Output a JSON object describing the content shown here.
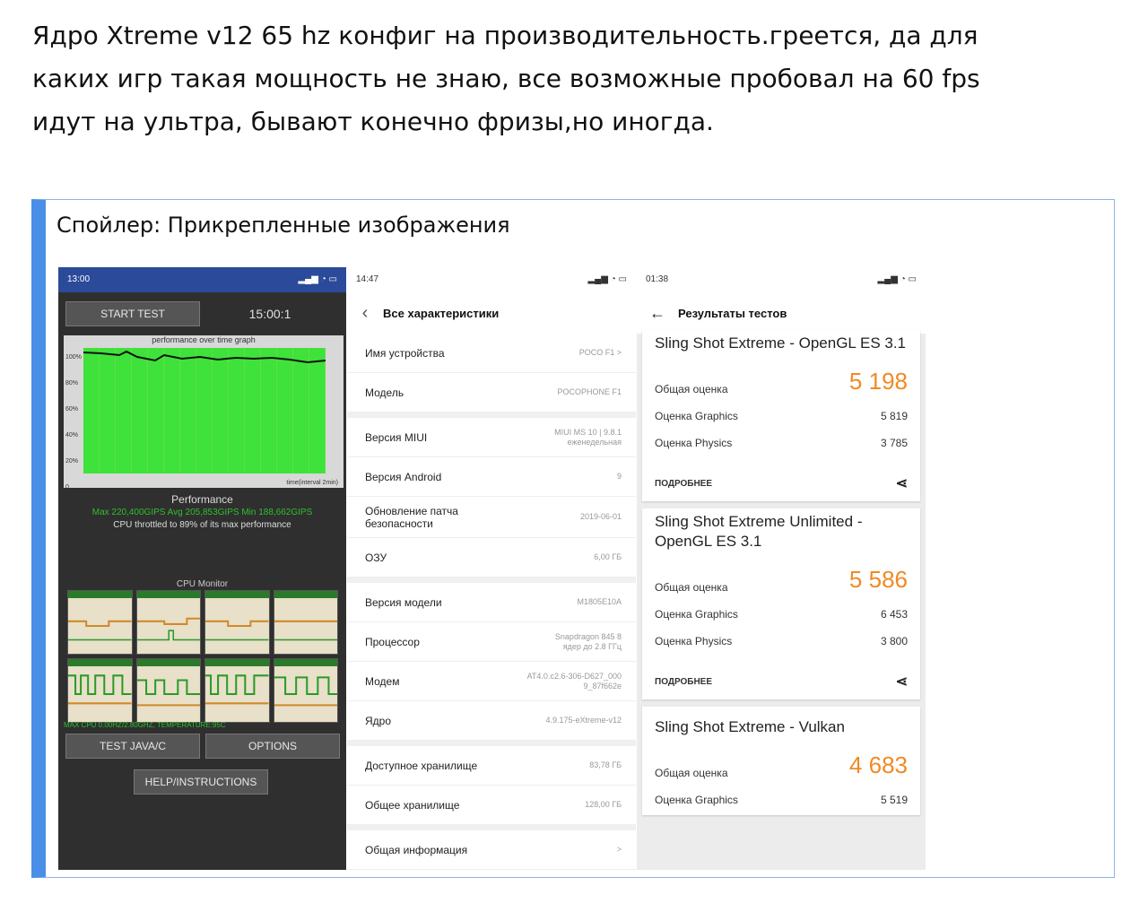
{
  "post": {
    "text_lines": [
      "Ядро Xtreme v12 65 hz конфиг на производительность.греется, да для",
      "каких игр такая мощность не знаю, все возможные пробовал на 60 fps",
      "идут на ультра, бывают конечно фризы,но иногда."
    ]
  },
  "spoiler": {
    "title": "Спойлер: Прикрепленные изображения"
  },
  "shot1": {
    "time": "13:00",
    "status_icons": "signal wifi battery",
    "start_test": "START TEST",
    "timer": "15:00:1",
    "graph_title": "performance over time graph",
    "y_labels": [
      "100%",
      "80%",
      "60%",
      "40%",
      "20%",
      "0"
    ],
    "graph_footer": "time(interval 2min)",
    "performance": "Performance",
    "perf_stats": "Max 220,400GIPS   Avg 205,853GIPS   Min 188,662GIPS",
    "throttle": "CPU throttled to 89% of its max performance",
    "cpu_monitor": "CPU Monitor",
    "max_cpu": "MAX CPU 0.00HZ/2.80GHZ, TEMPERATURE:95C",
    "test_java": "TEST JAVA/C",
    "options": "OPTIONS",
    "help": "HELP/INSTRUCTIONS"
  },
  "shot2": {
    "time": "14:47",
    "title": "Все характеристики",
    "groups": [
      [
        {
          "k": "Имя устройства",
          "v": "POCO F1  >"
        },
        {
          "k": "Модель",
          "v": "POCOPHONE F1"
        }
      ],
      [
        {
          "k": "Версия MIUI",
          "v": "MIUI MS 10 | 9.8.1 еженедельная"
        },
        {
          "k": "Версия Android",
          "v": "9"
        },
        {
          "k": "Обновление патча безопасности",
          "v": "2019-06-01"
        },
        {
          "k": "ОЗУ",
          "v": "6,00 ГБ"
        }
      ],
      [
        {
          "k": "Версия модели",
          "v": "M1805E10A"
        },
        {
          "k": "Процессор",
          "v": "Snapdragon 845 8 ядер до 2.8 ГГц"
        },
        {
          "k": "Модем",
          "v": "AT4.0.c2.6-306-D627_0009_87f662e"
        },
        {
          "k": "Ядро",
          "v": "4.9.175-eXtreme-v12"
        }
      ],
      [
        {
          "k": "Доступное хранилище",
          "v": "83,78 ГБ"
        },
        {
          "k": "Общее хранилище",
          "v": "128,00 ГБ"
        }
      ],
      [
        {
          "k": "Общая информация",
          "v": ">"
        }
      ]
    ]
  },
  "shot3": {
    "time": "01:38",
    "title": "Результаты тестов",
    "cards": [
      {
        "title": "Sling Shot Extreme - OpenGL ES 3.1",
        "score_label": "Общая оценка",
        "score": "5 198",
        "g_label": "Оценка Graphics",
        "g": "5 819",
        "p_label": "Оценка Physics",
        "p": "3 785",
        "more": "ПОДРОБНЕЕ"
      },
      {
        "title": "Sling Shot Extreme Unlimited - OpenGL ES 3.1",
        "score_label": "Общая оценка",
        "score": "5 586",
        "g_label": "Оценка Graphics",
        "g": "6 453",
        "p_label": "Оценка Physics",
        "p": "3 800",
        "more": "ПОДРОБНЕЕ"
      },
      {
        "title": "Sling Shot Extreme - Vulkan",
        "score_label": "Общая оценка",
        "score": "4 683",
        "g_label": "Оценка Graphics",
        "g": "5 519",
        "p_label": "",
        "p": "",
        "more": ""
      }
    ]
  },
  "colors": {
    "accent_blue": "#4a8ee8",
    "score_orange": "#f08a24",
    "graph_green": "#3fe23a"
  }
}
